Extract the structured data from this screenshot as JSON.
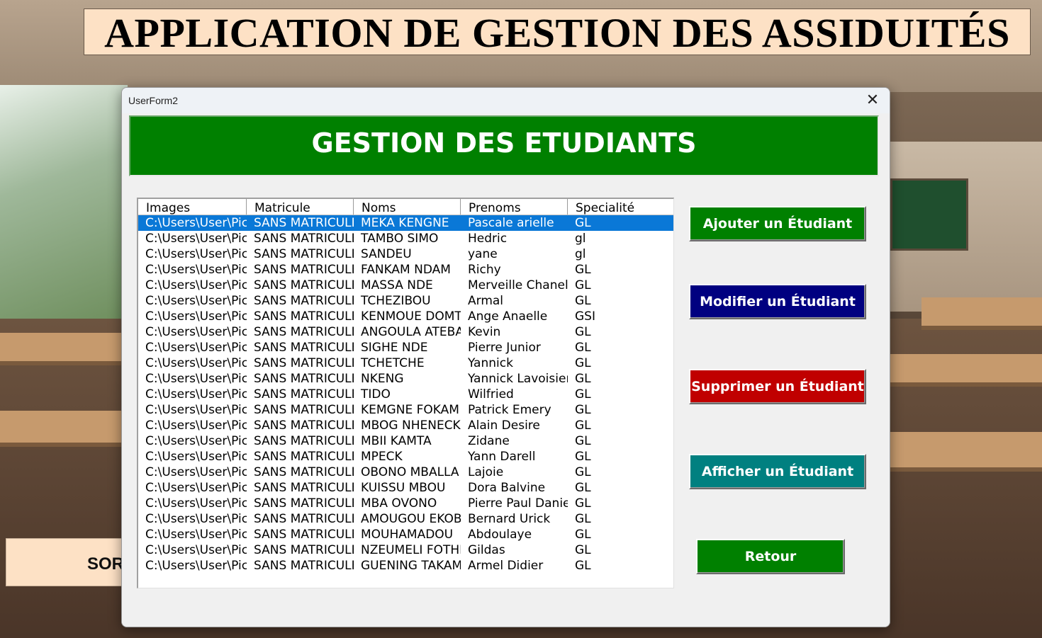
{
  "app": {
    "title": "APPLICATION DE GESTION DES ASSIDUITÉS",
    "side_button_label": "SORTIR"
  },
  "dialog": {
    "title": "UserForm2",
    "close_glyph": "✕",
    "banner": "GESTION DES ETUDIANTS",
    "columns": [
      "Images",
      "Matricule",
      "Noms",
      "Prenoms",
      "Specialité"
    ],
    "rows": [
      [
        "C:\\Users\\User\\Pic",
        "SANS MATRICULE",
        "MEKA KENGNE",
        "Pascale arielle",
        "GL"
      ],
      [
        "C:\\Users\\User\\Pic",
        "SANS MATRICULE",
        "TAMBO SIMO",
        "Hedric",
        "gl"
      ],
      [
        "C:\\Users\\User\\Pic",
        "SANS MATRICULE",
        "SANDEU",
        "yane",
        "gl"
      ],
      [
        "C:\\Users\\User\\Pic",
        "SANS MATRICULE",
        "FANKAM NDAM",
        "Richy",
        "GL"
      ],
      [
        "C:\\Users\\User\\Pic",
        "SANS MATRICULE",
        "MASSA NDE",
        "Merveille Chanel",
        "GL"
      ],
      [
        "C:\\Users\\User\\Pic",
        "SANS MATRICULE",
        "TCHEZIBOU",
        "Armal",
        "GL"
      ],
      [
        "C:\\Users\\User\\Pic",
        "SANS MATRICULE",
        "KENMOUE DOMTCHEU",
        "Ange Anaelle",
        "GSI"
      ],
      [
        "C:\\Users\\User\\Pic",
        "SANS MATRICULE",
        "ANGOULA ATEBA",
        "Kevin",
        "GL"
      ],
      [
        "C:\\Users\\User\\Pic",
        "SANS MATRICULE",
        "SIGHE NDE",
        "Pierre Junior",
        "GL"
      ],
      [
        "C:\\Users\\User\\Pic",
        "SANS MATRICULE",
        "TCHETCHE",
        "Yannick",
        "GL"
      ],
      [
        "C:\\Users\\User\\Pic",
        "SANS MATRICULE",
        "NKENG",
        "Yannick Lavoisier",
        "GL"
      ],
      [
        "C:\\Users\\User\\Pic",
        "SANS MATRICULE",
        "TIDO",
        "Wilfried",
        "GL"
      ],
      [
        "C:\\Users\\User\\Pic",
        "SANS MATRICULE",
        "KEMGNE FOKAM",
        "Patrick Emery",
        "GL"
      ],
      [
        "C:\\Users\\User\\Pic",
        "SANS MATRICULE",
        "MBOG NHENECK",
        "Alain Desire",
        "GL"
      ],
      [
        "C:\\Users\\User\\Pic",
        "SANS MATRICULE",
        "MBII KAMTA",
        "Zidane",
        "GL"
      ],
      [
        "C:\\Users\\User\\Pic",
        "SANS MATRICULE",
        "MPECK",
        "Yann Darell",
        "GL"
      ],
      [
        "C:\\Users\\User\\Pic",
        "SANS MATRICULE",
        "OBONO MBALLA",
        "Lajoie",
        "GL"
      ],
      [
        "C:\\Users\\User\\Pic",
        "SANS MATRICULE",
        "KUISSU MBOU",
        "Dora Balvine",
        "GL"
      ],
      [
        "C:\\Users\\User\\Pic",
        "SANS MATRICULE",
        "MBA OVONO",
        "Pierre Paul Daniel",
        "GL"
      ],
      [
        "C:\\Users\\User\\Pic",
        "SANS MATRICULE",
        "AMOUGOU EKOBO",
        "Bernard Urick",
        "GL"
      ],
      [
        "C:\\Users\\User\\Pic",
        "SANS MATRICULE",
        "MOUHAMADOU",
        "Abdoulaye",
        "GL"
      ],
      [
        "C:\\Users\\User\\Pic",
        "SANS MATRICULE",
        "NZEUMELI FOTHE",
        "Gildas",
        "GL"
      ],
      [
        "C:\\Users\\User\\Pic",
        "SANS MATRICULE",
        "GUENING TAKAM",
        "Armel Didier",
        "GL"
      ]
    ],
    "selected_row": 0,
    "buttons": {
      "add": "Ajouter un Étudiant",
      "edit": "Modifier un Étudiant",
      "delete": "Supprimer un Étudiant",
      "show": "Afficher un Étudiant",
      "back": "Retour"
    }
  },
  "colors": {
    "banner": "#008000",
    "add": "#008000",
    "edit": "#000080",
    "delete": "#c00000",
    "show": "#008080",
    "back": "#008000",
    "selection": "#0a78d7",
    "title_background": "#fde1c5"
  }
}
